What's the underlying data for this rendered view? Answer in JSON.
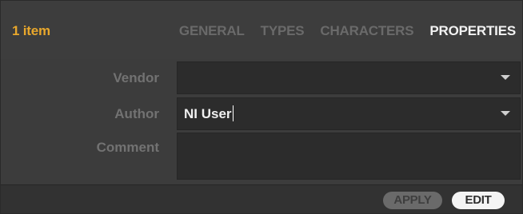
{
  "header": {
    "item_count": "1 item",
    "tabs": [
      {
        "label": "GENERAL",
        "active": false
      },
      {
        "label": "TYPES",
        "active": false
      },
      {
        "label": "CHARACTERS",
        "active": false
      },
      {
        "label": "PROPERTIES",
        "active": true
      }
    ]
  },
  "form": {
    "vendor": {
      "label": "Vendor",
      "value": ""
    },
    "author": {
      "label": "Author",
      "value": "NI User"
    },
    "comment": {
      "label": "Comment",
      "value": ""
    }
  },
  "footer": {
    "apply_label": "APPLY",
    "edit_label": "EDIT"
  },
  "colors": {
    "accent": "#e8a72c",
    "active_tab": "#f2f2f2",
    "inactive_tab": "#6a6a6a",
    "field_bg": "#2c2c2c",
    "panel_bg": "#3d3d3d"
  },
  "icons": {
    "vendor_dropdown": "chevron-down-icon",
    "author_dropdown": "chevron-down-icon"
  }
}
